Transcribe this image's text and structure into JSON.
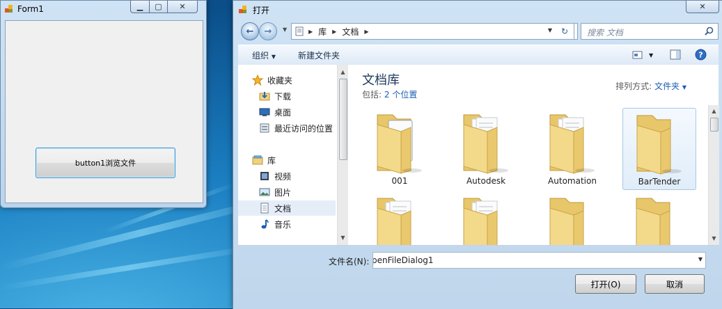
{
  "form1": {
    "title": "Form1",
    "button_label": "button1浏览文件"
  },
  "dialog": {
    "title": "打开",
    "breadcrumb": [
      "库",
      "文档"
    ],
    "search_placeholder": "搜索 文档",
    "toolbar": {
      "organize": "组织",
      "new_folder": "新建文件夹"
    },
    "nav": {
      "favorites": "收藏夹",
      "downloads": "下载",
      "desktop": "桌面",
      "recent": "最近访问的位置",
      "libraries": "库",
      "videos": "视频",
      "pictures": "图片",
      "documents": "文档",
      "music": "音乐"
    },
    "library": {
      "title": "文档库",
      "includes_label": "包括:",
      "includes_link": "2 个位置",
      "arrange_label": "排列方式:",
      "arrange_value": "文件夹"
    },
    "folders": [
      {
        "name": "001"
      },
      {
        "name": "Autodesk"
      },
      {
        "name": "Automation"
      },
      {
        "name": "BarTender"
      },
      {
        "name": ""
      },
      {
        "name": ""
      },
      {
        "name": ""
      },
      {
        "name": ""
      }
    ],
    "filename_label": "文件名(N):",
    "filename_value": "penFileDialog1",
    "open_button": "打开(O)",
    "cancel_button": "取消"
  },
  "colors": {
    "accent": "#3c9ad6",
    "link": "#1a5fb4",
    "title_green": "#1e395b",
    "close_red": "#c4442a"
  }
}
